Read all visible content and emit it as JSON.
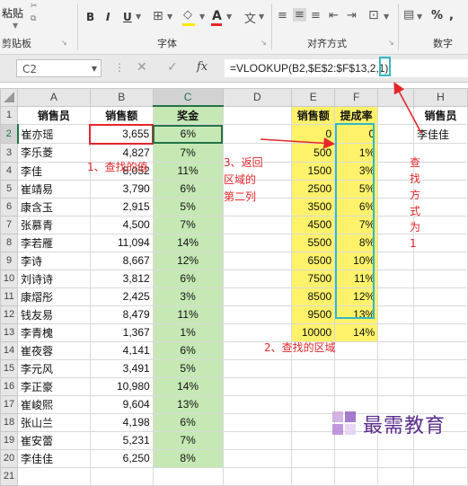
{
  "ribbon": {
    "paste_label": "粘贴",
    "clipboard_label": "剪贴板",
    "font_label": "字体",
    "alignment_label": "对齐方式",
    "number_label": "数字",
    "bold": "B",
    "italic": "I",
    "underline": "U",
    "font_color": "A",
    "wen": "文",
    "percent": "%",
    "comma": ","
  },
  "formula_bar": {
    "name_box": "C2",
    "cancel": "✕",
    "enter": "✓",
    "fx": "fx",
    "formula": "=VLOOKUP(B2,$E$2:$F$13,2,1)"
  },
  "columns": [
    "",
    "A",
    "B",
    "C",
    "D",
    "E",
    "F",
    "",
    "H"
  ],
  "rows": [
    {
      "n": "1",
      "a": "销售员",
      "b": "销售额",
      "c": "奖金",
      "e": "销售额",
      "f": "提成率",
      "h": "销售员"
    },
    {
      "n": "2",
      "a": "崔亦瑶",
      "b": "3,655",
      "c": "6%",
      "e": "0",
      "f": "0",
      "h": "李佳佳"
    },
    {
      "n": "3",
      "a": "李乐菱",
      "b": "4,827",
      "c": "7%",
      "e": "500",
      "f": "1%",
      "h": ""
    },
    {
      "n": "4",
      "a": "李佳",
      "b": "8,052",
      "c": "11%",
      "e": "1500",
      "f": "3%",
      "h": ""
    },
    {
      "n": "5",
      "a": "崔靖易",
      "b": "3,790",
      "c": "6%",
      "e": "2500",
      "f": "5%",
      "h": ""
    },
    {
      "n": "6",
      "a": "康含玉",
      "b": "2,915",
      "c": "5%",
      "e": "3500",
      "f": "6%",
      "h": ""
    },
    {
      "n": "7",
      "a": "张慕青",
      "b": "4,500",
      "c": "7%",
      "e": "4500",
      "f": "7%",
      "h": ""
    },
    {
      "n": "8",
      "a": "李若雁",
      "b": "11,094",
      "c": "14%",
      "e": "5500",
      "f": "8%",
      "h": ""
    },
    {
      "n": "9",
      "a": "李诗",
      "b": "8,667",
      "c": "12%",
      "e": "6500",
      "f": "10%",
      "h": ""
    },
    {
      "n": "10",
      "a": "刘诗诗",
      "b": "3,812",
      "c": "6%",
      "e": "7500",
      "f": "11%",
      "h": ""
    },
    {
      "n": "11",
      "a": "康熠彤",
      "b": "2,425",
      "c": "3%",
      "e": "8500",
      "f": "12%",
      "h": ""
    },
    {
      "n": "12",
      "a": "钱友易",
      "b": "8,479",
      "c": "11%",
      "e": "9500",
      "f": "13%",
      "h": ""
    },
    {
      "n": "13",
      "a": "李青槐",
      "b": "1,367",
      "c": "1%",
      "e": "10000",
      "f": "14%",
      "h": ""
    },
    {
      "n": "14",
      "a": "崔夜蓉",
      "b": "4,141",
      "c": "6%",
      "e": "",
      "f": "",
      "h": ""
    },
    {
      "n": "15",
      "a": "李元风",
      "b": "3,491",
      "c": "5%",
      "e": "",
      "f": "",
      "h": ""
    },
    {
      "n": "16",
      "a": "李正豪",
      "b": "10,980",
      "c": "14%",
      "e": "",
      "f": "",
      "h": ""
    },
    {
      "n": "17",
      "a": "崔峻熙",
      "b": "9,604",
      "c": "13%",
      "e": "",
      "f": "",
      "h": ""
    },
    {
      "n": "18",
      "a": "张山兰",
      "b": "4,198",
      "c": "6%",
      "e": "",
      "f": "",
      "h": ""
    },
    {
      "n": "19",
      "a": "崔安蕾",
      "b": "5,231",
      "c": "7%",
      "e": "",
      "f": "",
      "h": ""
    },
    {
      "n": "20",
      "a": "李佳佳",
      "b": "6,250",
      "c": "8%",
      "e": "",
      "f": "",
      "h": ""
    },
    {
      "n": "21",
      "a": "",
      "b": "",
      "c": "",
      "e": "",
      "f": "",
      "h": ""
    }
  ],
  "annotations": {
    "step1": "1、查找的值",
    "step2": "2、查找的区域",
    "step3_line1": "3、返回",
    "step3_line2": "区域的",
    "step3_line3": "第二列",
    "step4_chars": [
      "查",
      "找",
      "方",
      "式",
      "为",
      "1"
    ]
  },
  "watermark": "最需教育",
  "colors": {
    "annotation_red": "#e4262a",
    "highlight_teal": "#34b8c4",
    "bonus_green": "#c6e8b4",
    "lookup_yellow": "#fdf26a",
    "excel_green": "#217346"
  }
}
